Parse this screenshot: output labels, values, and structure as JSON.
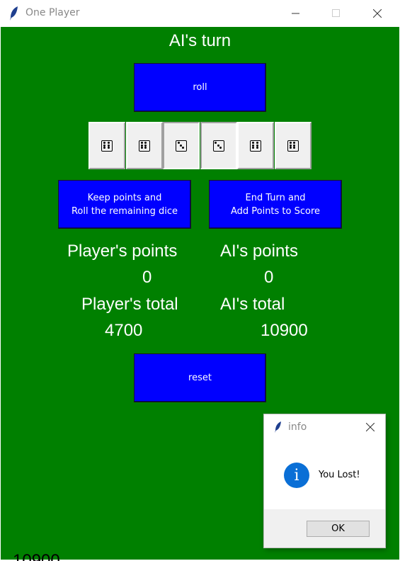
{
  "window": {
    "title": "One Player"
  },
  "game": {
    "turn_label": "AI's turn",
    "roll_label": "roll",
    "keep_label_line1": "Keep points and",
    "keep_label_line2": "Roll the remaining dice",
    "end_label_line1": "End Turn and",
    "end_label_line2": "Add Points to Score",
    "reset_label": "reset",
    "dice": [
      6,
      6,
      3,
      3,
      6,
      6
    ],
    "dice_selected": [
      false,
      false,
      true,
      true,
      false,
      false
    ],
    "player_points_label": "Player's points",
    "ai_points_label": "AI's points",
    "player_points": "0",
    "ai_points": "0",
    "player_total_label": "Player's total",
    "ai_total_label": "AI's total",
    "player_total": "4700",
    "ai_total": "10900"
  },
  "dialog": {
    "title": "info",
    "message": "You Lost!",
    "ok_label": "OK"
  },
  "colors": {
    "background": "#008000",
    "button": "#0000ff",
    "info_icon": "#0a6fd6"
  }
}
